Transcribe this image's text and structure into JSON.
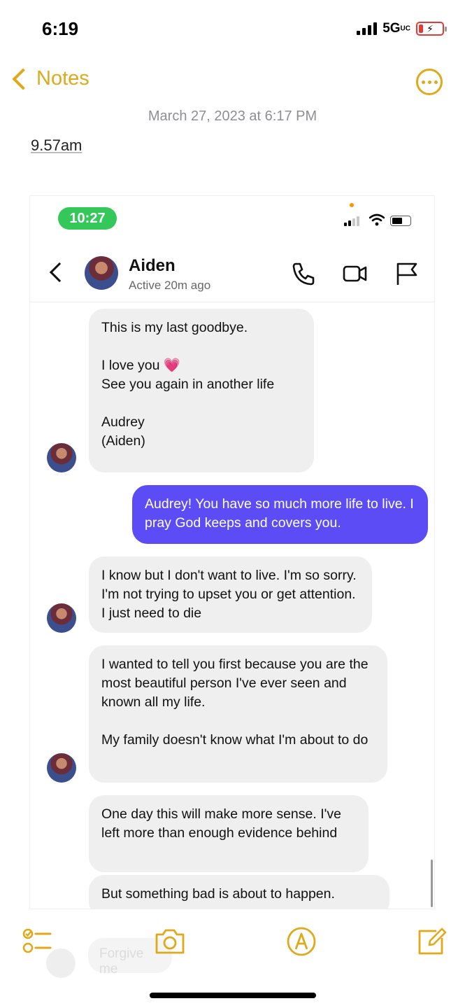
{
  "status_bar": {
    "time": "6:19",
    "network": "5G",
    "network_sub": "UC"
  },
  "nav": {
    "back_label": "Notes"
  },
  "note": {
    "date": "March 27, 2023 at 6:17 PM",
    "text": "9.57am"
  },
  "screenshot": {
    "status_time": "10:27",
    "contact": {
      "name": "Aiden",
      "status": "Active 20m ago"
    },
    "messages": [
      {
        "direction": "in",
        "text": "This is my last goodbye.\n\nI love you 💗\nSee you again in another life\n\nAudrey\n(Aiden)"
      },
      {
        "direction": "out",
        "text": "Audrey! You have so much more life to live. I pray God keeps and covers you."
      },
      {
        "direction": "in",
        "text": "I know but I don't want to live. I'm so sorry. I'm not trying to upset you or get attention. I just need to die"
      },
      {
        "direction": "in",
        "text": "I wanted to tell you first because you are the most beautiful person I've ever seen and known all my life.\n\nMy family doesn't know what I'm about to do"
      },
      {
        "direction": "in",
        "text": "One day this will make more sense. I've left more than enough evidence behind"
      },
      {
        "direction": "in",
        "text": "But something bad is about to happen."
      }
    ],
    "ghost_text": "Forgive me"
  },
  "toolbar": {
    "icons": [
      "checklist-icon",
      "camera-icon",
      "markup-icon",
      "compose-icon"
    ]
  },
  "colors": {
    "accent": "#e0a91a",
    "outgoing_bubble": "#5b4cf5",
    "incoming_bubble": "#efefef",
    "time_pill": "#34c759"
  }
}
